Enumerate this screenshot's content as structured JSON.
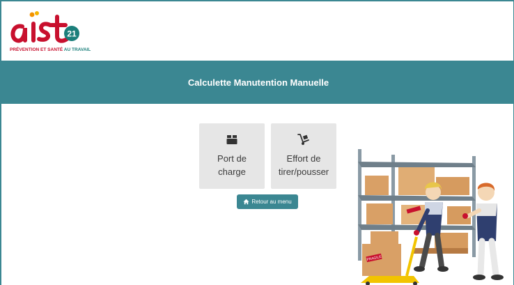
{
  "logo": {
    "tagline_main": "PRÉVENTION ET SANTÉ",
    "tagline_accent": "AU TRAVAIL"
  },
  "banner": {
    "title": "Calculette Manutention Manuelle"
  },
  "cards": [
    {
      "icon": "box-icon",
      "label_line1": "Port de",
      "label_line2": "charge"
    },
    {
      "icon": "hand-truck-icon",
      "label_line1": "Effort de",
      "label_line2": "tirer/pousser"
    }
  ],
  "back_button": {
    "icon": "home-icon",
    "label": "Retour au menu"
  },
  "illustration": {
    "box_label": "FRAGILE"
  },
  "colors": {
    "accent": "#3b8792",
    "brand_red": "#c8102e",
    "brand_green": "#1b7f7b",
    "card_bg": "#e6e6e6"
  }
}
